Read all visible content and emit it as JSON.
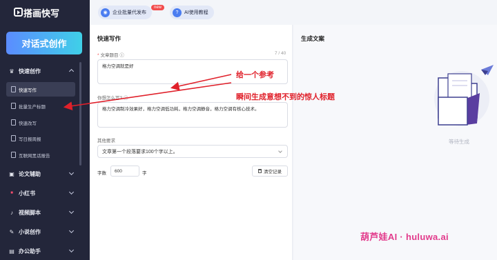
{
  "sidebar": {
    "logo": "搭画快写",
    "primary_button": "对话式创作",
    "sections": [
      {
        "label": "快速创作",
        "icon": "crown-icon"
      },
      {
        "label": "论文辅助",
        "icon": "book-icon"
      },
      {
        "label": "小红书",
        "icon": "xiaohongshu-icon"
      },
      {
        "label": "视频脚本",
        "icon": "tiktok-icon"
      },
      {
        "label": "小说创作",
        "icon": "novel-icon"
      },
      {
        "label": "办公助手",
        "icon": "chart-icon"
      }
    ],
    "sub_items": [
      "快速写作",
      "批量生产标题",
      "快速改写",
      "写日报周报",
      "互联网黑话报告"
    ]
  },
  "topbar": {
    "batch_label": "企业批量代发布",
    "new_badge": "new",
    "tutorial_label": "AI使用教程"
  },
  "form": {
    "title": "快速写作",
    "topic_label": "文章题目",
    "topic_counter": "7 / 40",
    "topic_value": "格力空调就是好",
    "howto_label": "你想怎么写?",
    "howto_value": "格力空调制冷效果好，格力空调低功耗，格力空调静音，格力空调有核心技术。",
    "other_label": "其他要求",
    "other_value": "文章第一个段落要求100个字以上。",
    "word_count_label": "字数",
    "word_count_value": "600",
    "word_count_unit": "字",
    "clear_button": "清空记录"
  },
  "result": {
    "title": "生成文案",
    "empty_text": "等待生成"
  },
  "annotations": {
    "ref": "给一个参考",
    "headline": "瞬间生成意想不到的惊人标题",
    "watermark": "葫芦娃AI · huluwa.ai"
  },
  "colors": {
    "sidebar_bg": "#23263a",
    "accent_gradient_start": "#5b8cff",
    "accent_gradient_end": "#3fd0e8",
    "annotation_red": "#e0202a",
    "watermark_pink": "#e23a8b"
  }
}
